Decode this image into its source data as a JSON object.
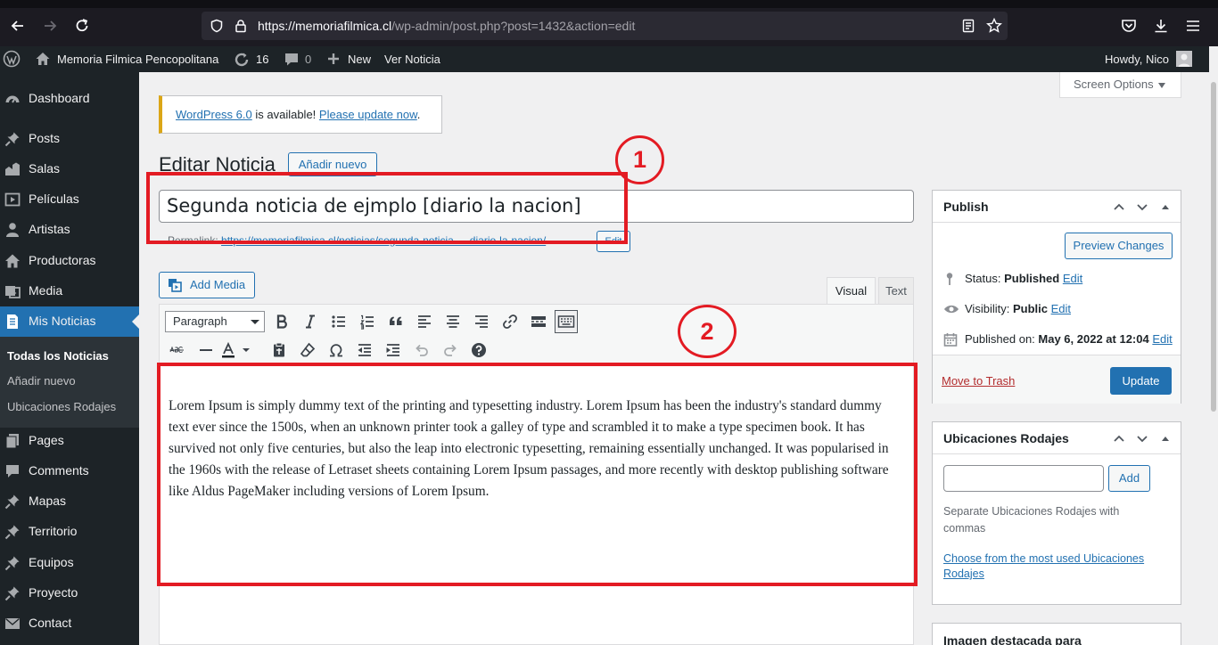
{
  "browser": {
    "url_host": "https://memoriafilmica.cl",
    "url_path": "/wp-admin/post.php?post=1432&action=edit"
  },
  "adminbar": {
    "site_name": "Memoria Filmica Pencopolitana",
    "updates_count": "16",
    "comments_count": "0",
    "new_label": "New",
    "view_label": "Ver Noticia",
    "howdy": "Howdy, Nico"
  },
  "sidebar": {
    "items": [
      {
        "label": "Dashboard",
        "icon": "dashboard-icon"
      },
      {
        "label": "Posts",
        "icon": "pin-icon"
      },
      {
        "label": "Salas",
        "icon": "building-icon"
      },
      {
        "label": "Películas",
        "icon": "video-icon"
      },
      {
        "label": "Artistas",
        "icon": "user-icon"
      },
      {
        "label": "Productoras",
        "icon": "home-icon"
      },
      {
        "label": "Media",
        "icon": "media-icon"
      },
      {
        "label": "Mis Noticias",
        "icon": "page-icon"
      },
      {
        "label": "Pages",
        "icon": "pages-icon"
      },
      {
        "label": "Comments",
        "icon": "comment-icon"
      },
      {
        "label": "Mapas",
        "icon": "pin-icon"
      },
      {
        "label": "Territorio",
        "icon": "pin-icon"
      },
      {
        "label": "Equipos",
        "icon": "pin-icon"
      },
      {
        "label": "Proyecto",
        "icon": "pin-icon"
      },
      {
        "label": "Contact",
        "icon": "mail-icon"
      }
    ],
    "submenu": [
      "Todas los Noticias",
      "Añadir nuevo",
      "Ubicaciones Rodajes"
    ]
  },
  "screen_options": "Screen Options",
  "notice": {
    "link1": "WordPress 6.0",
    "middle": " is available! ",
    "link2": "Please update now",
    "end": "."
  },
  "page": {
    "title": "Editar Noticia",
    "add_new": "Añadir nuevo",
    "post_title": "Segunda noticia de ejmplo [diario la nacion]",
    "permalink_label": "Permalink: ",
    "permalink_url": "https://memoriafilmica.cl/noticias/segunda-noticia-...-diario-la-nacion/",
    "permalink_edit": "Edit"
  },
  "editor": {
    "add_media": "Add Media",
    "tab_visual": "Visual",
    "tab_text": "Text",
    "format": "Paragraph",
    "content": "Lorem Ipsum is simply dummy text of the printing and typesetting industry. Lorem Ipsum has been the industry's standard dummy text ever since the 1500s, when an unknown printer took a galley of type and scrambled it to make a type specimen book. It has survived not only five centuries, but also the leap into electronic typesetting, remaining essentially unchanged. It was popularised in the 1960s with the release of Letraset sheets containing Lorem Ipsum passages, and more recently with desktop publishing software like Aldus PageMaker including versions of Lorem Ipsum."
  },
  "publish": {
    "title": "Publish",
    "preview": "Preview Changes",
    "status_label": "Status: ",
    "status_value": "Published",
    "visibility_label": "Visibility: ",
    "visibility_value": "Public",
    "published_label": "Published on: ",
    "published_value": "May 6, 2022 at 12:04",
    "edit": "Edit",
    "trash": "Move to Trash",
    "update": "Update"
  },
  "ubicaciones": {
    "title": "Ubicaciones Rodajes",
    "add": "Add",
    "hint": "Separate Ubicaciones Rodajes with commas",
    "link": "Choose from the most used Ubicaciones Rodajes"
  },
  "imagen": {
    "title": "Imagen destacada para"
  },
  "annotations": [
    "1",
    "2"
  ],
  "colors": {
    "accent": "#2271b1",
    "annotation_red": "#e31b23",
    "adminbar": "#1d2327"
  }
}
